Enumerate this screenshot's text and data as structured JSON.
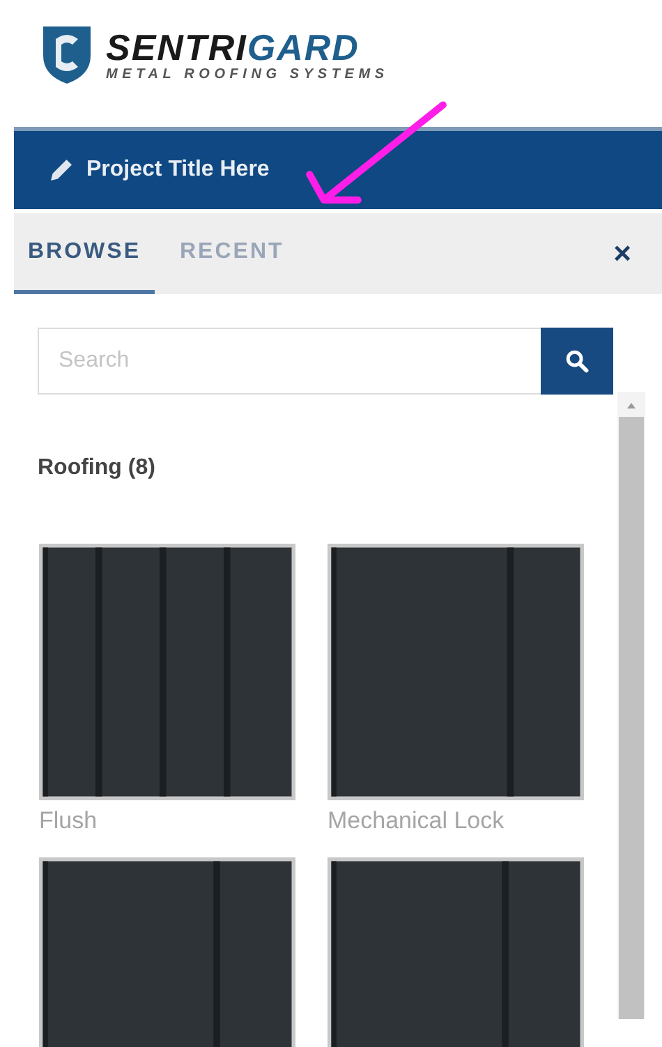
{
  "logo": {
    "brand_dark": "SENTRI",
    "brand_accent": "GARD",
    "tagline": "METAL ROOFING SYSTEMS"
  },
  "project_bar": {
    "title": "Project Title Here"
  },
  "tabs": [
    {
      "label": "BROWSE",
      "selected": true
    },
    {
      "label": "RECENT",
      "selected": false
    }
  ],
  "close_label": "×",
  "search": {
    "placeholder": "Search"
  },
  "category": {
    "title": "Roofing (8)"
  },
  "products": [
    {
      "kind": "four-seam",
      "label": "Flush"
    },
    {
      "kind": "one-seam",
      "label": "Mechanical Lock"
    },
    {
      "kind": "one-seam-mid"
    },
    {
      "kind": "one-seam-mid"
    }
  ]
}
